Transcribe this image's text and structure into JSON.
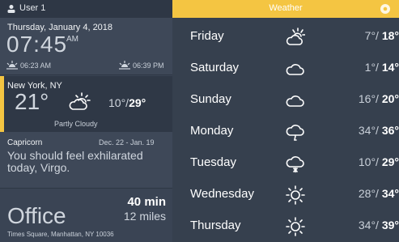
{
  "user": {
    "label": "User 1"
  },
  "clock": {
    "date": "Thursday, January 4, 2018",
    "time": "07:45",
    "ampm": "AM",
    "sunrise": "06:23 AM",
    "sunset": "06:39 PM"
  },
  "current_weather": {
    "city": "New York, NY",
    "temp": "21°",
    "low": "10°/",
    "high": "29°",
    "condition": "Partly Cloudy",
    "icon": "partly-cloudy-icon"
  },
  "horoscope": {
    "sign": "Capricorn",
    "dates": "Dec. 22 - Jan. 19",
    "text": "You should feel exhilarated today, Virgo."
  },
  "commute": {
    "destination": "Office",
    "minutes": "40 min",
    "miles": "12 miles",
    "address": "Times Square, Manhattan, NY 10036"
  },
  "forecast": {
    "title": "Weather",
    "days": [
      {
        "name": "Friday",
        "low": "7°/",
        "high": "18°",
        "icon": "partly-cloudy-icon"
      },
      {
        "name": "Saturday",
        "low": "1°/",
        "high": "14°",
        "icon": "cloud-icon"
      },
      {
        "name": "Sunday",
        "low": "16°/",
        "high": "20°",
        "icon": "cloud-icon"
      },
      {
        "name": "Monday",
        "low": "34°/",
        "high": "36°",
        "icon": "rain-cloud-icon"
      },
      {
        "name": "Tuesday",
        "low": "10°/",
        "high": "29°",
        "icon": "snow-cloud-icon"
      },
      {
        "name": "Wednesday",
        "low": "28°/",
        "high": "34°",
        "icon": "sun-icon"
      },
      {
        "name": "Thursday",
        "low": "34°/",
        "high": "39°",
        "icon": "sun-icon"
      }
    ]
  },
  "colors": {
    "accent": "#f4c542",
    "panel": "#36404e",
    "card": "#3e4858"
  }
}
